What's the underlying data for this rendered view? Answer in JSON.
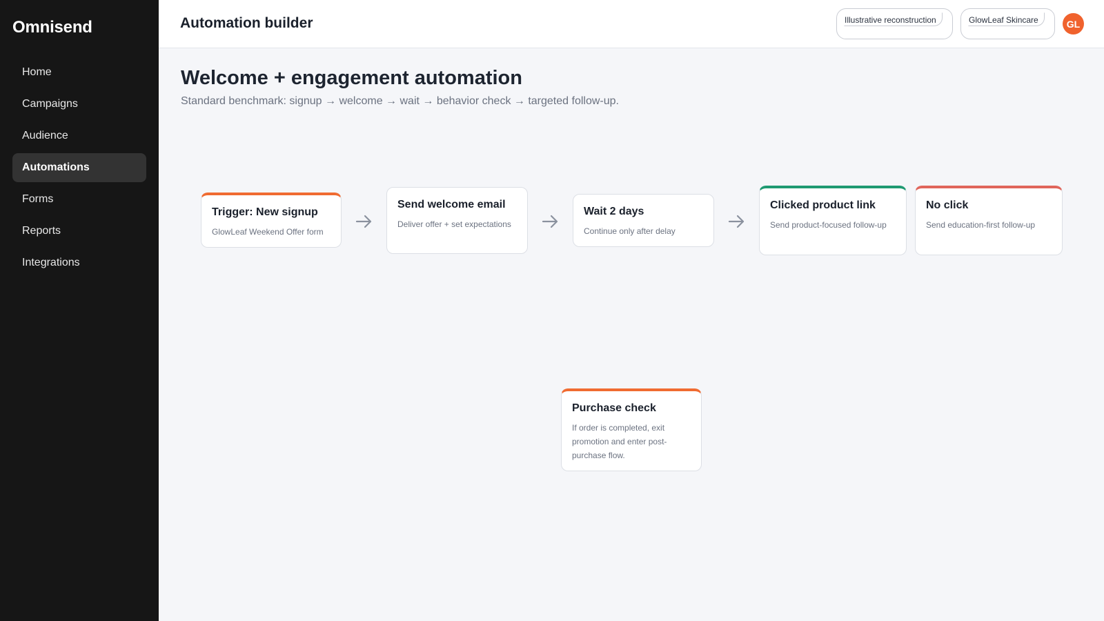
{
  "app": {
    "brand": "Omnisend"
  },
  "sidebar": {
    "items": [
      {
        "label": "Home",
        "active": false
      },
      {
        "label": "Campaigns",
        "active": false
      },
      {
        "label": "Audience",
        "active": false
      },
      {
        "label": "Automations",
        "active": true
      },
      {
        "label": "Forms",
        "active": false
      },
      {
        "label": "Reports",
        "active": false
      },
      {
        "label": "Integrations",
        "active": false
      }
    ]
  },
  "header": {
    "title": "Automation builder",
    "badge_1": "Illustrative reconstruction",
    "badge_2": "GlowLeaf Skincare",
    "avatar_initials": "GL"
  },
  "main": {
    "title": "Welcome + engagement automation",
    "subtitle": "Standard benchmark: signup → welcome → wait → behavior check → targeted follow-up."
  },
  "flow": {
    "trigger": {
      "title": "Trigger: New signup",
      "description": "GlowLeaf Weekend Offer form"
    },
    "welcome": {
      "title": "Send welcome email",
      "description": "Deliver offer + set expectations"
    },
    "wait": {
      "title": "Wait 2 days",
      "description": "Continue only after delay"
    },
    "clicked": {
      "title": "Clicked product link",
      "description": "Send product-focused follow-up"
    },
    "no_click": {
      "title": "No click",
      "description": "Send education-first follow-up"
    },
    "purchase": {
      "title": "Purchase check",
      "description": "If order is completed, exit promotion and enter post-purchase flow."
    }
  },
  "colors": {
    "accent_orange": "#f06b31",
    "accent_green": "#1f9a72",
    "accent_red": "#e0655b",
    "sidebar_bg": "#161616",
    "avatar_bg": "#f0622d"
  }
}
